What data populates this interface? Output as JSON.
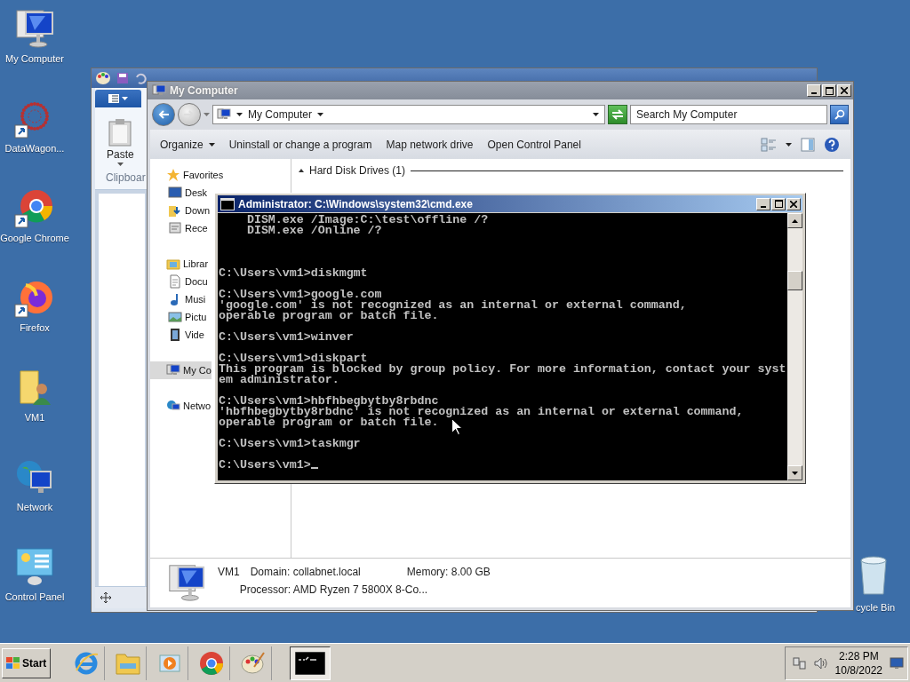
{
  "desktop_icons": [
    {
      "label": "My Computer",
      "kind": "computer"
    },
    {
      "label": "DataWagon...",
      "kind": "datawagon"
    },
    {
      "label": "Google Chrome",
      "kind": "chrome"
    },
    {
      "label": "Firefox",
      "kind": "firefox"
    },
    {
      "label": "VM1",
      "kind": "user-folder"
    },
    {
      "label": "Network",
      "kind": "network"
    },
    {
      "label": "Control Panel",
      "kind": "control-panel"
    }
  ],
  "recycle_bin": {
    "label": "cycle Bin"
  },
  "paint": {
    "paste_label": "Paste",
    "group_label": "Clipboar"
  },
  "explorer": {
    "title": "My Computer",
    "address": "My Computer",
    "search": {
      "placeholder": "Search My Computer"
    },
    "commands": [
      "Organize",
      "Uninstall or change a program",
      "Map network drive",
      "Open Control Panel"
    ],
    "nav": [
      {
        "label": "Favorites",
        "kind": "favorites",
        "selected": false,
        "children": [
          {
            "label": "Desk",
            "kind": "desktop",
            "selected": false
          },
          {
            "label": "Down",
            "kind": "downloads",
            "selected": false
          },
          {
            "label": "Rece",
            "kind": "recent",
            "selected": false
          }
        ]
      },
      {
        "label": "Librar",
        "kind": "libraries",
        "selected": false,
        "children": [
          {
            "label": "Docu",
            "kind": "documents",
            "selected": false
          },
          {
            "label": "Musi",
            "kind": "music",
            "selected": false
          },
          {
            "label": "Pictu",
            "kind": "pictures",
            "selected": false
          },
          {
            "label": "Vide",
            "kind": "videos",
            "selected": false
          }
        ]
      },
      {
        "label": "My Co",
        "kind": "computer",
        "selected": true
      },
      {
        "label": "Netwo",
        "kind": "network",
        "selected": false
      }
    ],
    "section": "Hard Disk Drives (1)",
    "details": {
      "name": "VM1",
      "domain": "Domain: collabnet.local",
      "memory": "Memory: 8.00 GB",
      "processor": "Processor: AMD Ryzen 7 5800X 8-Co..."
    }
  },
  "console": {
    "title": "Administrator: C:\\Windows\\system32\\cmd.exe",
    "scrollback": [
      "    DISM.exe /Image:C:\\test\\offline /?",
      "    DISM.exe /Online /?"
    ],
    "blocks": [
      [
        "C:\\Users\\vm1>diskmgmt"
      ],
      [
        "C:\\Users\\vm1>google.com",
        "'google.com' is not recognized as an internal or external command,",
        "operable program or batch file."
      ],
      [
        "C:\\Users\\vm1>winver"
      ],
      [
        "C:\\Users\\vm1>diskpart",
        "This program is blocked by group policy. For more information, contact your syst",
        "em administrator."
      ],
      [
        "C:\\Users\\vm1>hbfhbegbytby8rbdnc",
        "'hbfhbegbytby8rbdnc' is not recognized as an internal or external command,",
        "operable program or batch file."
      ],
      [
        "C:\\Users\\vm1>taskmgr"
      ]
    ],
    "prompt": "C:\\Users\\vm1>"
  },
  "taskbar": {
    "start": "Start",
    "tasks": [
      {
        "kind": "console",
        "selected": true
      }
    ],
    "time": "2:28 PM",
    "date": "10/8/2022"
  }
}
